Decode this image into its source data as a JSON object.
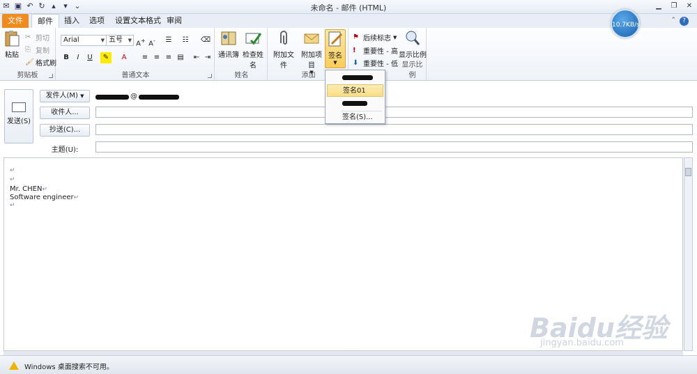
{
  "window": {
    "title": "未命名 - 邮件 (HTML)"
  },
  "tabs": [
    {
      "label": "文件"
    },
    {
      "label": "邮件"
    },
    {
      "label": "插入"
    },
    {
      "label": "选项"
    },
    {
      "label": "设置文本格式"
    },
    {
      "label": "审阅"
    }
  ],
  "ribbon": {
    "clipboard": {
      "label": "剪贴板",
      "paste": "粘贴",
      "cut": "剪切",
      "copy": "复制",
      "format_painter": "格式刷"
    },
    "text": {
      "label": "普通文本",
      "font": "Arial",
      "size": "五号",
      "bold": "B",
      "italic": "I",
      "underline": "U"
    },
    "names": {
      "label": "姓名",
      "address_book": "通讯簿",
      "check_names": "检查姓名"
    },
    "include": {
      "label": "添加",
      "attach_file": "附加文件",
      "attach_item": "附加项目",
      "signature": "签名"
    },
    "tags": {
      "follow_up": "后续标志",
      "high": "重要性 - 高",
      "low": "重要性 - 低"
    },
    "zoom": {
      "label": "显示比例",
      "zoom": "显示比例"
    }
  },
  "signature_menu": {
    "items": [
      {
        "label": "签名01"
      }
    ],
    "signatures": "签名(S)..."
  },
  "header": {
    "send": "发送(S)",
    "from": "发件人(M)",
    "from_at": "@",
    "to": "收件人...",
    "cc": "抄送(C)...",
    "subject": "主题(U):"
  },
  "body": {
    "name_line": "Mr. CHEN",
    "title_line": "Software engineer",
    "para_mark": "↵"
  },
  "status": {
    "text": "Windows 桌面搜索不可用。"
  },
  "speed_badge": "10.7KB/s",
  "watermark": {
    "main": "Baidu经验",
    "sub": "jingyan.baidu.com"
  }
}
